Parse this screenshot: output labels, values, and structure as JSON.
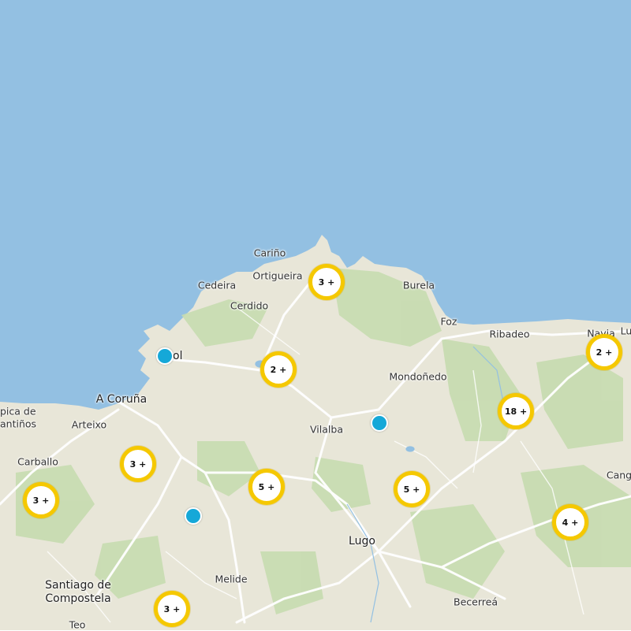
{
  "colors": {
    "sea": "#93c0e2",
    "land": "#e8e6d8",
    "forest": "#c6dcb0",
    "road": "#ffffff",
    "cluster_ring": "#f5c800",
    "pin": "#15a8d8"
  },
  "places": [
    {
      "id": "carino",
      "label": "Cariño"
    },
    {
      "id": "cedeira",
      "label": "Cedeira"
    },
    {
      "id": "ortigueira",
      "label": "Ortigueira"
    },
    {
      "id": "burela",
      "label": "Burela"
    },
    {
      "id": "cerdido",
      "label": "Cerdido"
    },
    {
      "id": "foz",
      "label": "Foz"
    },
    {
      "id": "ribadeo",
      "label": "Ribadeo"
    },
    {
      "id": "navia",
      "label": "Navia"
    },
    {
      "id": "lu",
      "label": "Lu"
    },
    {
      "id": "ferrol",
      "label": "F  ol"
    },
    {
      "id": "mondonedo",
      "label": "Mondoñedo"
    },
    {
      "id": "acoruna",
      "label": "A Coruña"
    },
    {
      "id": "arteixo",
      "label": "Arteixo"
    },
    {
      "id": "costa1",
      "label": "pica de"
    },
    {
      "id": "costa2",
      "label": "antiños"
    },
    {
      "id": "vilalba",
      "label": "Vilalba"
    },
    {
      "id": "carballo",
      "label": "Carballo"
    },
    {
      "id": "cangas",
      "label": "Cang"
    },
    {
      "id": "lugo",
      "label": "Lugo"
    },
    {
      "id": "melide",
      "label": "Melide"
    },
    {
      "id": "santiago",
      "label": "Santiago de\nCompostela"
    },
    {
      "id": "becerrea",
      "label": "Becerreá"
    },
    {
      "id": "teo",
      "label": "Teo"
    }
  ],
  "clusters": [
    {
      "id": "c1",
      "label": "3 +"
    },
    {
      "id": "c2",
      "label": "2 +"
    },
    {
      "id": "c3",
      "label": "2 +"
    },
    {
      "id": "c4",
      "label": "18 +"
    },
    {
      "id": "c5",
      "label": "3 +"
    },
    {
      "id": "c6",
      "label": "3 +"
    },
    {
      "id": "c7",
      "label": "5 +"
    },
    {
      "id": "c8",
      "label": "5 +"
    },
    {
      "id": "c9",
      "label": "4 +"
    },
    {
      "id": "c10",
      "label": "3 +"
    }
  ]
}
